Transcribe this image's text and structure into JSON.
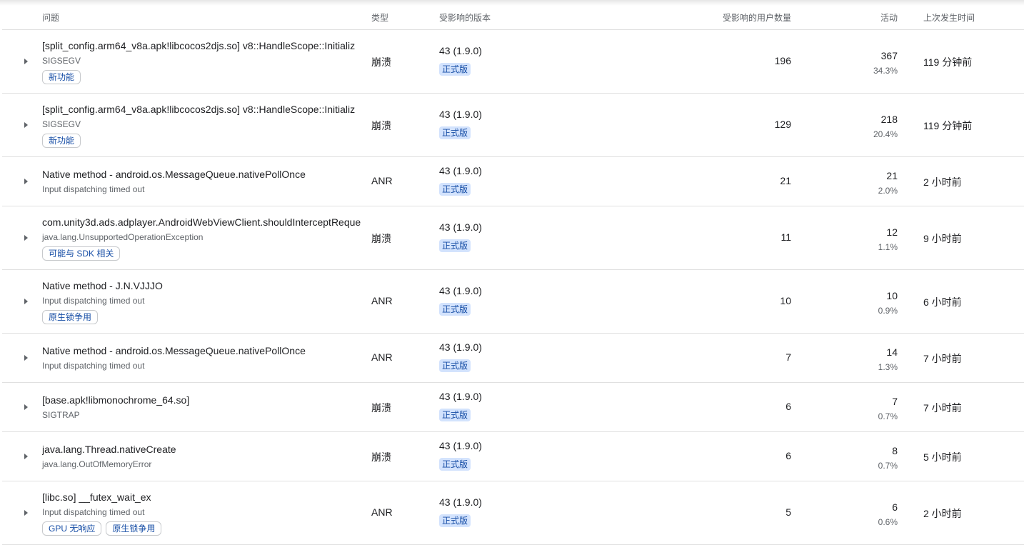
{
  "header": {
    "issue": "问题",
    "type": "类型",
    "versions": "受影响的版本",
    "users": "受影响的用户数量",
    "events": "活动",
    "last_seen": "上次发生时间"
  },
  "rows": [
    {
      "title": "[split_config.arm64_v8a.apk!libcocos2djs.so] v8::HandleScope::Initializ",
      "subtitle": "SIGSEGV",
      "tags": [
        "新功能"
      ],
      "type": "崩溃",
      "version": "43 (1.9.0)",
      "track": "正式版",
      "users": "196",
      "events": "367",
      "events_pct": "34.3%",
      "last_seen": "119 分钟前"
    },
    {
      "title": "[split_config.arm64_v8a.apk!libcocos2djs.so] v8::HandleScope::Initializ",
      "subtitle": "SIGSEGV",
      "tags": [
        "新功能"
      ],
      "type": "崩溃",
      "version": "43 (1.9.0)",
      "track": "正式版",
      "users": "129",
      "events": "218",
      "events_pct": "20.4%",
      "last_seen": "119 分钟前"
    },
    {
      "title": "Native method - android.os.MessageQueue.nativePollOnce",
      "subtitle": "Input dispatching timed out",
      "tags": [],
      "type": "ANR",
      "version": "43 (1.9.0)",
      "track": "正式版",
      "users": "21",
      "events": "21",
      "events_pct": "2.0%",
      "last_seen": "2 小时前"
    },
    {
      "title": "com.unity3d.ads.adplayer.AndroidWebViewClient.shouldInterceptReque",
      "subtitle": "java.lang.UnsupportedOperationException",
      "tags": [
        "可能与 SDK 相关"
      ],
      "type": "崩溃",
      "version": "43 (1.9.0)",
      "track": "正式版",
      "users": "11",
      "events": "12",
      "events_pct": "1.1%",
      "last_seen": "9 小时前"
    },
    {
      "title": "Native method - J.N.VJJJO",
      "subtitle": "Input dispatching timed out",
      "tags": [
        "原生锁争用"
      ],
      "type": "ANR",
      "version": "43 (1.9.0)",
      "track": "正式版",
      "users": "10",
      "events": "10",
      "events_pct": "0.9%",
      "last_seen": "6 小时前"
    },
    {
      "title": "Native method - android.os.MessageQueue.nativePollOnce",
      "subtitle": "Input dispatching timed out",
      "tags": [],
      "type": "ANR",
      "version": "43 (1.9.0)",
      "track": "正式版",
      "users": "7",
      "events": "14",
      "events_pct": "1.3%",
      "last_seen": "7 小时前"
    },
    {
      "title": "[base.apk!libmonochrome_64.so]",
      "subtitle": "SIGTRAP",
      "tags": [],
      "type": "崩溃",
      "version": "43 (1.9.0)",
      "track": "正式版",
      "users": "6",
      "events": "7",
      "events_pct": "0.7%",
      "last_seen": "7 小时前"
    },
    {
      "title": "java.lang.Thread.nativeCreate",
      "subtitle": "java.lang.OutOfMemoryError",
      "tags": [],
      "type": "崩溃",
      "version": "43 (1.9.0)",
      "track": "正式版",
      "users": "6",
      "events": "8",
      "events_pct": "0.7%",
      "last_seen": "5 小时前"
    },
    {
      "title": "[libc.so] __futex_wait_ex",
      "subtitle": "Input dispatching timed out",
      "tags": [
        "GPU 无响应",
        "原生锁争用"
      ],
      "type": "ANR",
      "version": "43 (1.9.0)",
      "track": "正式版",
      "users": "5",
      "events": "6",
      "events_pct": "0.6%",
      "last_seen": "2 小时前"
    }
  ],
  "colors": {
    "chip_text": "#174ea6",
    "badge_bg": "#d3e3fd",
    "divider": "#e0e0e0",
    "secondary_text": "#5f6368"
  },
  "icons": {
    "expander": "triangle-right-icon"
  }
}
